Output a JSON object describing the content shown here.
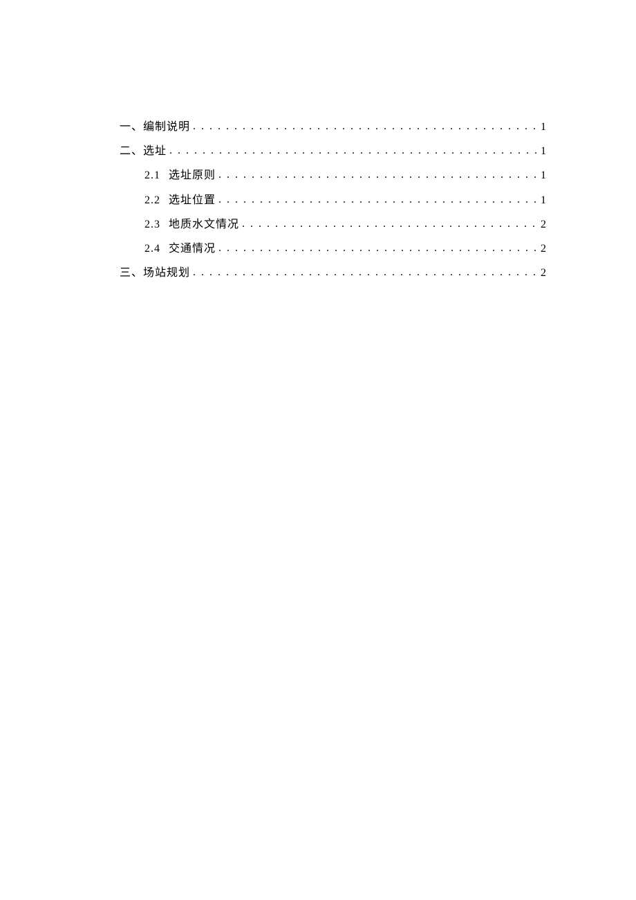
{
  "toc": {
    "entries": [
      {
        "level": 1,
        "num": "一、",
        "title": "编制说明",
        "page": "1"
      },
      {
        "level": 1,
        "num": "二、",
        "title": "选址",
        "page": "1"
      },
      {
        "level": 2,
        "num": "2.1",
        "title": "选址原则",
        "page": "1"
      },
      {
        "level": 2,
        "num": "2.2",
        "title": "选址位置",
        "page": "1"
      },
      {
        "level": 2,
        "num": "2.3",
        "title": "地质水文情况",
        "page": "2"
      },
      {
        "level": 2,
        "num": "2.4",
        "title": "交通情况",
        "page": "2"
      },
      {
        "level": 1,
        "num": "三、",
        "title": "场站规划",
        "page": "2"
      }
    ]
  }
}
